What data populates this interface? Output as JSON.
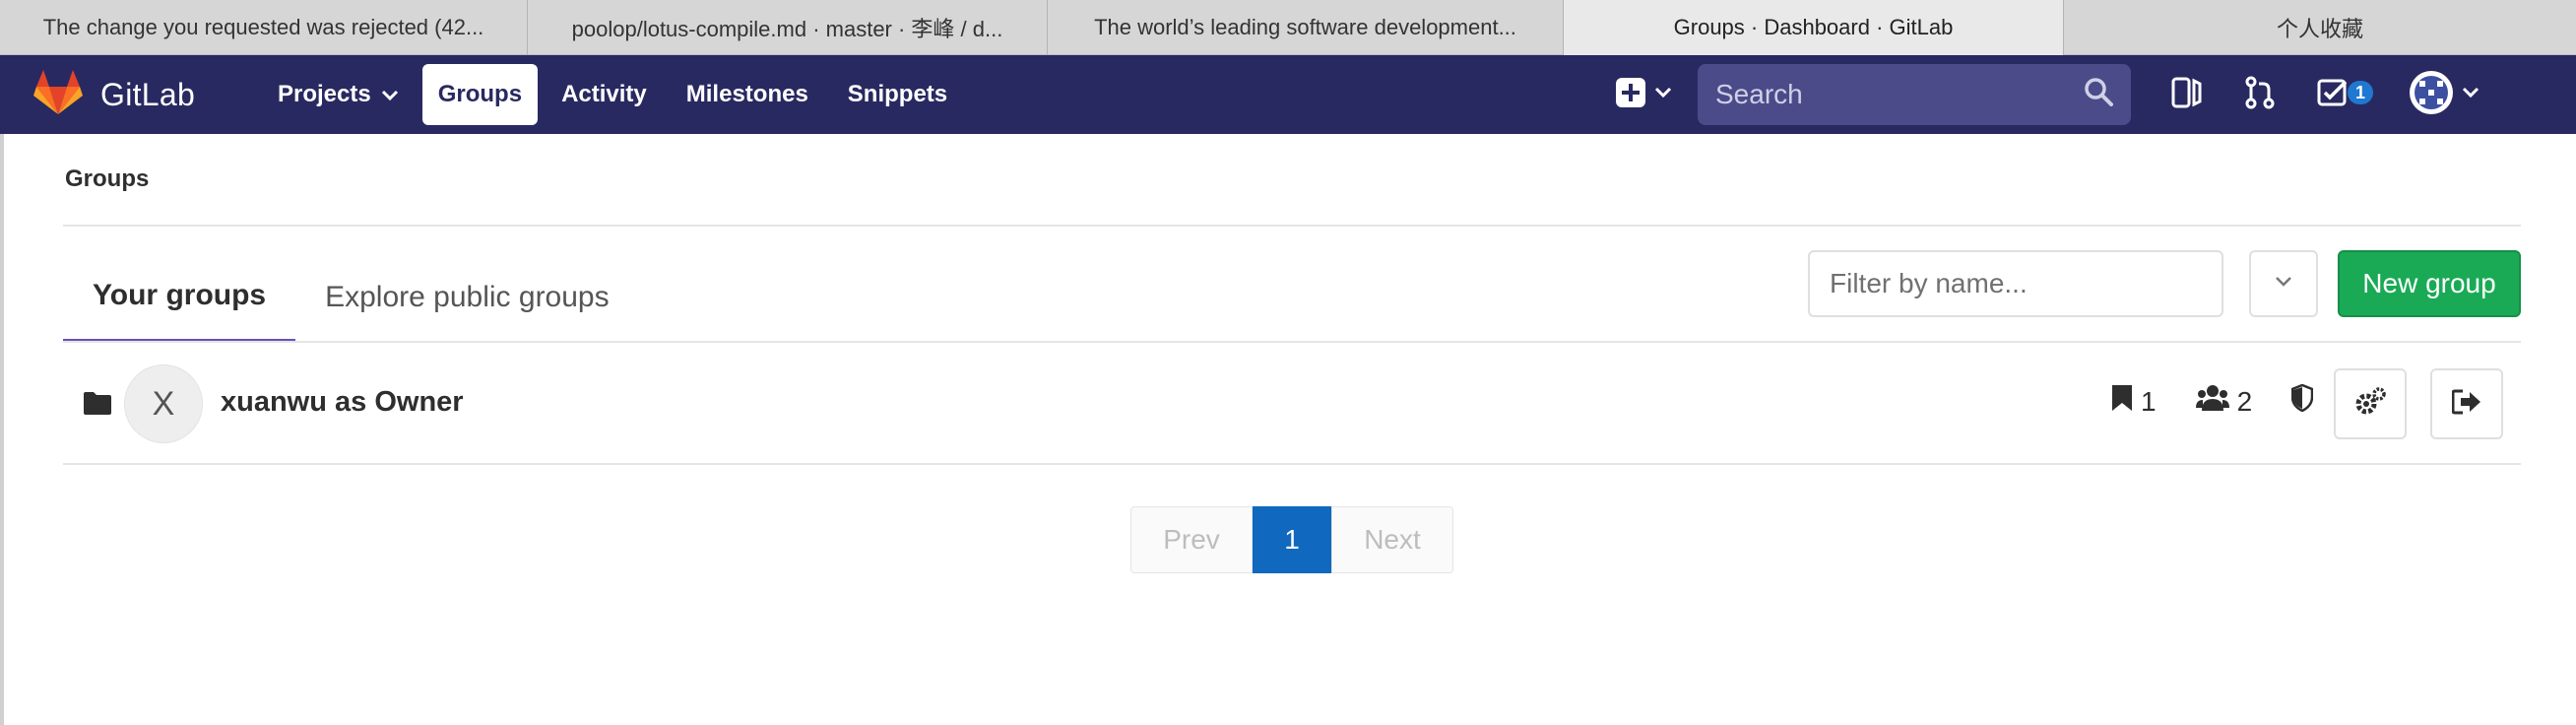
{
  "browser": {
    "tabs": [
      {
        "label": "The change you requested was rejected (42..."
      },
      {
        "label": "poolop/lotus-compile.md · master · 李峰 / d..."
      },
      {
        "label": "The world’s leading software development..."
      },
      {
        "label": "Groups · Dashboard · GitLab"
      },
      {
        "label": "个人收藏"
      }
    ]
  },
  "navbar": {
    "brand": "GitLab",
    "links": {
      "projects": "Projects",
      "groups": "Groups",
      "activity": "Activity",
      "milestones": "Milestones",
      "snippets": "Snippets"
    },
    "search_placeholder": "Search",
    "todo_count": "1",
    "colors": {
      "background": "#292961",
      "todo_badge": "#1f78d1"
    }
  },
  "breadcrumb": "Groups",
  "tabs": {
    "your_groups": "Your groups",
    "explore": "Explore public groups"
  },
  "filter": {
    "placeholder": "Filter by name..."
  },
  "new_group_label": "New group",
  "groups": [
    {
      "avatar_letter": "X",
      "title": "xuanwu as Owner",
      "projects_count": "1",
      "members_count": "2"
    }
  ],
  "pagination": {
    "prev": "Prev",
    "current": "1",
    "next": "Next"
  },
  "colors": {
    "accent_tab": "#6b4fbb",
    "primary_button": "#1aaa55",
    "page_active": "#1068bf"
  }
}
